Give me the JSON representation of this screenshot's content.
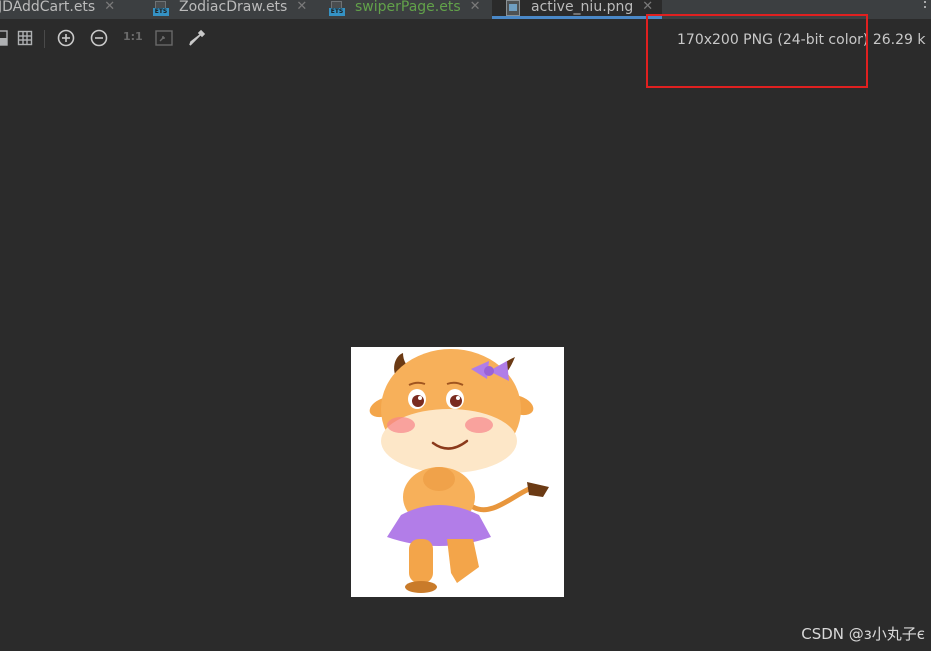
{
  "tabs": [
    {
      "label": "JDAddCart.ets",
      "icon": "ets-file-icon",
      "active": false
    },
    {
      "label": "ZodiacDraw.ets",
      "icon": "ets-file-icon",
      "active": false
    },
    {
      "label": "swiperPage.ets",
      "icon": "ets-file-icon",
      "active": false,
      "color": "#62a14a"
    },
    {
      "label": "active_niu.png",
      "icon": "png-file-icon",
      "active": true
    }
  ],
  "tab_close_glyph": "✕",
  "file_badge": "ETS",
  "toolbar": {
    "icons": [
      "chessboard-icon",
      "grid-icon",
      "zoom-in-icon",
      "zoom-out-icon",
      "actual-size-icon",
      "fit-zoom-icon",
      "color-picker-icon"
    ],
    "actual_size_label": "1:1"
  },
  "image_info": "170x200 PNG (24-bit color) 26.29 k",
  "image": {
    "subject": "cartoon-calf-image",
    "background": "#ffffff"
  },
  "watermark": "CSDN @з小丸子є",
  "colors": {
    "editor_bg": "#2b2b2b",
    "tabbar_bg": "#3c3f41",
    "active_tab_underline": "#4a88c7",
    "highlight_box": "#e02020"
  }
}
